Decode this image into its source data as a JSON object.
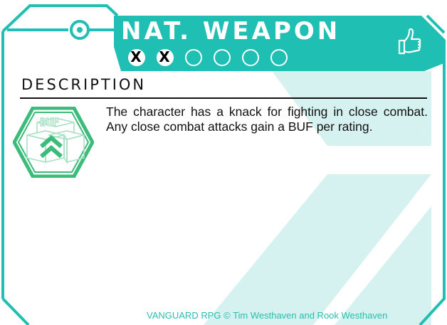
{
  "card": {
    "title": "NAT. WEAPON",
    "ratings": [
      {
        "marked": true,
        "mark": "X"
      },
      {
        "marked": true,
        "mark": "X"
      },
      {
        "marked": false,
        "mark": ""
      },
      {
        "marked": false,
        "mark": ""
      },
      {
        "marked": false,
        "mark": ""
      },
      {
        "marked": false,
        "mark": ""
      }
    ],
    "section_title": "DESCRIPTION",
    "description": "The character has a knack for fighting in close combat. Any close combat attacks gain a BUF per rating.",
    "badge_label": "BUF",
    "footer": "VANGUARD RPG © Tim Westhaven and Rook Westhaven"
  },
  "colors": {
    "accent": "#1fbfb3",
    "watermark": "#d6f2f0",
    "badge_green": "#3dbb7a"
  },
  "icons": {
    "thumb": "thumbs-up-icon",
    "badge": "buf-badge-icon",
    "key": "key-loop-icon"
  }
}
